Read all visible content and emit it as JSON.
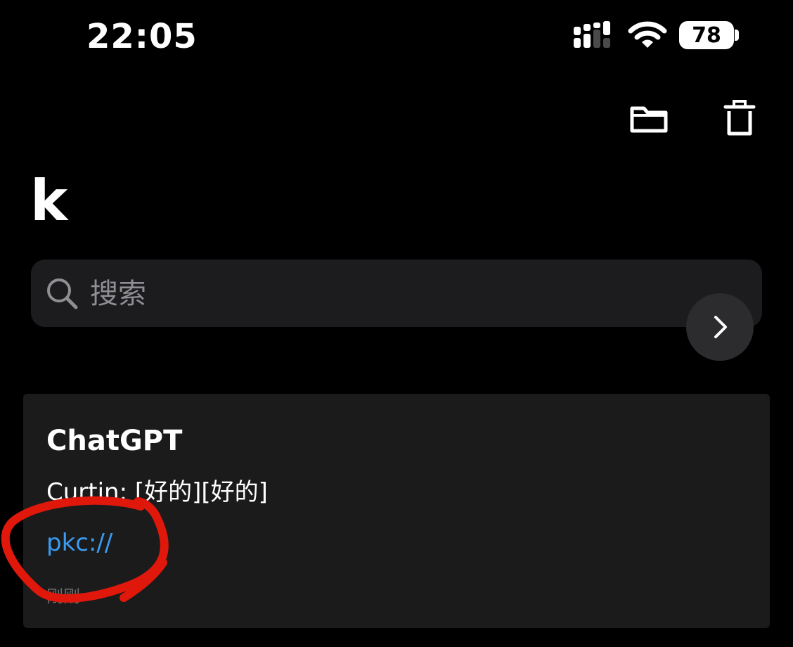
{
  "status_bar": {
    "time": "22:05",
    "battery": "78",
    "icons": [
      "cellular-signal-icon",
      "wifi-icon",
      "battery-icon"
    ]
  },
  "toolbar": {
    "icons": [
      "folder-icon",
      "trash-icon"
    ]
  },
  "page": {
    "title": "k"
  },
  "search": {
    "placeholder": "搜索",
    "value": ""
  },
  "next_button": {
    "icon": "chevron-right-icon"
  },
  "note_card": {
    "title": "ChatGPT",
    "preview": "Curtin: [好的][好的]",
    "link": "pkc://",
    "timestamp": "刚刚"
  },
  "colors": {
    "background": "#000000",
    "search_background": "#1c1c1e",
    "card_background": "#1b1b1b",
    "link": "#3a9bf0",
    "annotation": "#e0180c"
  }
}
